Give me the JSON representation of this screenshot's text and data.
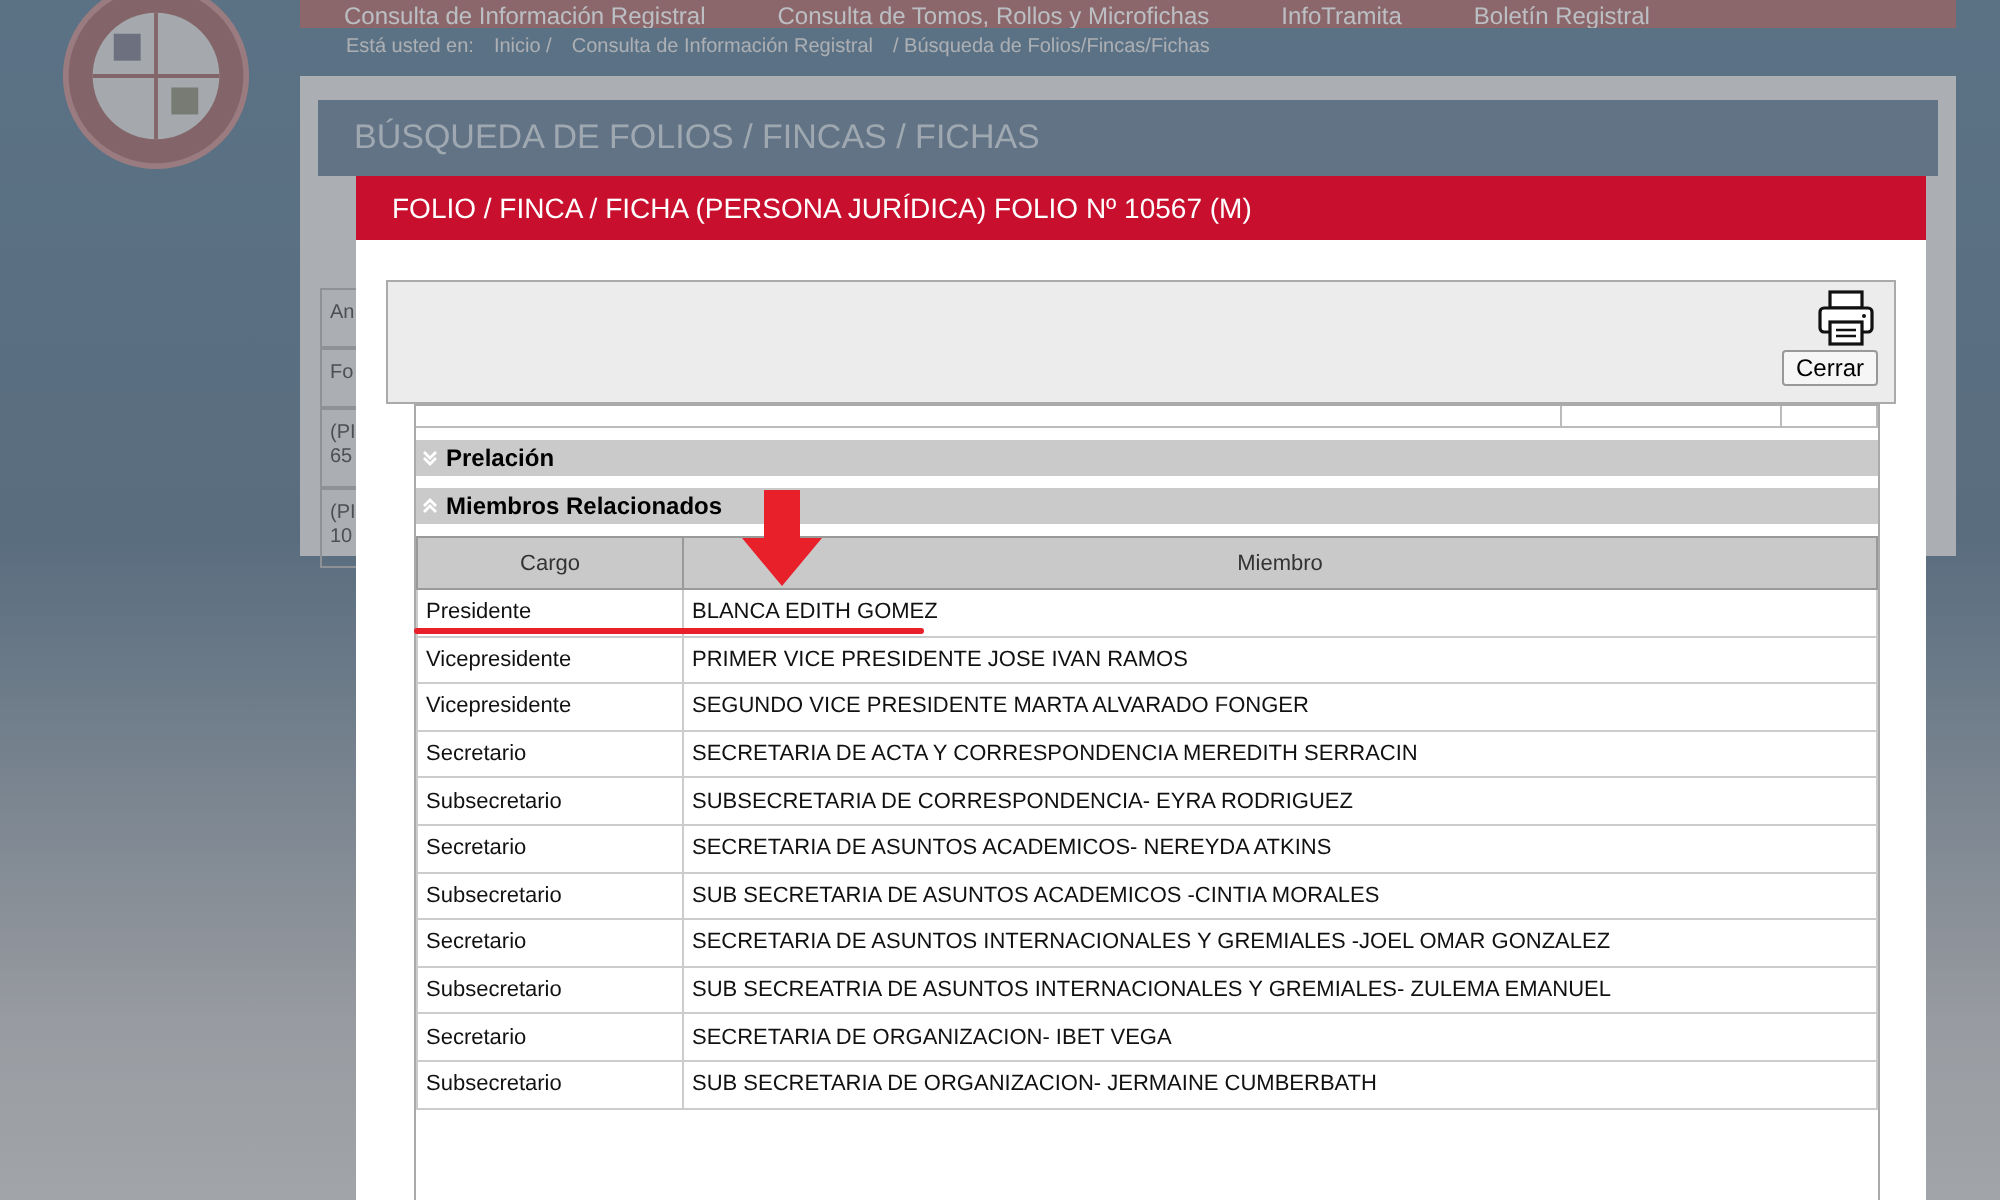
{
  "nav": {
    "items": [
      "Consulta de Información Registral",
      "Consulta de Tomos, Rollos y Microfichas",
      "InfoTramita",
      "Boletín Registral"
    ]
  },
  "breadcrumb": {
    "label": "Está usted en:",
    "items": [
      "Inicio /",
      "Consulta de Información Registral",
      "/ Búsqueda de Folios/Fincas/Fichas"
    ]
  },
  "page": {
    "title": "BÚSQUEDA DE FOLIOS / FINCAS / FICHAS",
    "background_cells": [
      "An",
      "Fo",
      "(PI\n65",
      "(PI\n10"
    ]
  },
  "modal": {
    "title": "FOLIO / FINCA / FICHA (PERSONA JURÍDICA) FOLIO Nº 10567 (M)",
    "close_label": "Cerrar",
    "sections": [
      {
        "label": "Prelación",
        "expanded": false
      },
      {
        "label": "Miembros Relacionados",
        "expanded": true
      }
    ],
    "table": {
      "columns": [
        "Cargo",
        "Miembro"
      ],
      "rows": [
        {
          "cargo": "Presidente",
          "miembro": "BLANCA EDITH GOMEZ",
          "highlighted": true
        },
        {
          "cargo": "Vicepresidente",
          "miembro": "PRIMER VICE PRESIDENTE JOSE IVAN RAMOS",
          "highlighted": false
        },
        {
          "cargo": "Vicepresidente",
          "miembro": "SEGUNDO VICE PRESIDENTE MARTA ALVARADO FONGER",
          "highlighted": false
        },
        {
          "cargo": "Secretario",
          "miembro": "SECRETARIA DE ACTA Y CORRESPONDENCIA MEREDITH SERRACIN",
          "highlighted": false
        },
        {
          "cargo": "Subsecretario",
          "miembro": "SUBSECRETARIA DE CORRESPONDENCIA- EYRA RODRIGUEZ",
          "highlighted": false
        },
        {
          "cargo": "Secretario",
          "miembro": "SECRETARIA DE ASUNTOS ACADEMICOS- NEREYDA ATKINS",
          "highlighted": false
        },
        {
          "cargo": "Subsecretario",
          "miembro": "SUB SECRETARIA DE ASUNTOS ACADEMICOS -CINTIA MORALES",
          "highlighted": false
        },
        {
          "cargo": "Secretario",
          "miembro": "SECRETARIA DE ASUNTOS INTERNACIONALES Y GREMIALES -JOEL OMAR GONZALEZ",
          "highlighted": false
        },
        {
          "cargo": "Subsecretario",
          "miembro": "SUB SECREATRIA DE ASUNTOS INTERNACIONALES Y GREMIALES- ZULEMA EMANUEL",
          "highlighted": false
        },
        {
          "cargo": "Secretario",
          "miembro": "SECRETARIA DE ORGANIZACION- IBET VEGA",
          "highlighted": false
        },
        {
          "cargo": "Subsecretario",
          "miembro": "SUB SECRETARIA DE ORGANIZACION- JERMAINE CUMBERBATH",
          "highlighted": false
        }
      ]
    }
  }
}
